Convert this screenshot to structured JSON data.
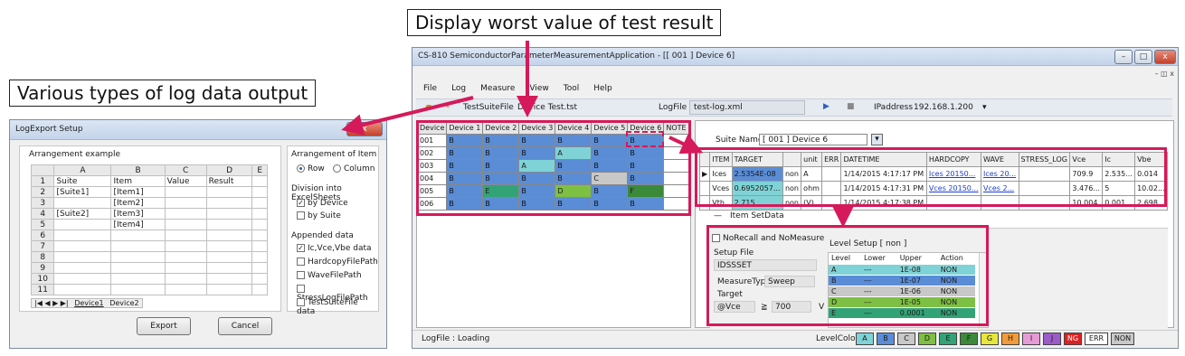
{
  "callouts": {
    "log": "Various types of log data output",
    "worst": "Display worst value of test result"
  },
  "export_dialog": {
    "title": "LogExport Setup",
    "close": "x",
    "arrangement_example": "Arrangement example",
    "columns": [
      "",
      "A",
      "B",
      "C",
      "D",
      "E"
    ],
    "rows": [
      [
        "1",
        "Suite",
        "Item",
        "Value",
        "Result",
        ""
      ],
      [
        "2",
        "[Suite1]",
        "[Item1]",
        "",
        "",
        ""
      ],
      [
        "3",
        "",
        "[Item2]",
        "",
        "",
        ""
      ],
      [
        "4",
        "[Suite2]",
        "[Item3]",
        "",
        "",
        ""
      ],
      [
        "5",
        "",
        "[Item4]",
        "",
        "",
        ""
      ],
      [
        "6",
        "",
        "",
        "",
        "",
        ""
      ],
      [
        "7",
        "",
        "",
        "",
        "",
        ""
      ],
      [
        "8",
        "",
        "",
        "",
        "",
        ""
      ],
      [
        "9",
        "",
        "",
        "",
        "",
        ""
      ],
      [
        "10",
        "",
        "",
        "",
        "",
        ""
      ],
      [
        "11",
        "",
        "",
        "",
        "",
        ""
      ]
    ],
    "sheet_nav": "|◀ ◀ ▶ ▶|",
    "sheet_tabs": [
      "Device1",
      "Device2"
    ],
    "arrangement_title": "Arrangement of Item",
    "row_label": "Row",
    "column_label": "Column",
    "division_title": "Division into ExcelSheets",
    "by_device": "by Device",
    "by_suite": "by Suite",
    "appended_title": "Appended data",
    "appended": [
      "Ic,Vce,Vbe data",
      "HardcopyFilePath",
      "WaveFilePath",
      "StressLogFilePath",
      "TestSuiteFile data"
    ],
    "appended_checked": [
      true,
      false,
      false,
      false,
      false
    ],
    "export": "Export",
    "cancel": "Cancel"
  },
  "app": {
    "title": "CS-810 SemiconductorParameterMeasurementApplication - [[ 001 ] Device 6]",
    "menu": [
      "File",
      "Log",
      "Measure",
      "View",
      "Tool",
      "Help"
    ],
    "suite_file": "TestSuiteFile",
    "suite_file_value": "Device Test.tst",
    "logfile_label": "LogFile",
    "logfile_value": "test-log.xml",
    "ip_label": "IPaddress",
    "ip_value": "192.168.1.200",
    "device_headers": [
      "Device",
      "Device 1",
      "Device 2",
      "Device 3",
      "Device 4",
      "Device 5",
      "Device 6",
      "NOTE"
    ],
    "device_rows": [
      {
        "id": "001",
        "cells": [
          "B",
          "B",
          "B",
          "B",
          "B",
          "B"
        ],
        "levels": [
          "B",
          "B",
          "B",
          "B",
          "B",
          "B"
        ]
      },
      {
        "id": "002",
        "cells": [
          "B",
          "B",
          "B",
          "A",
          "B",
          "B"
        ],
        "levels": [
          "B",
          "B",
          "B",
          "A",
          "B",
          "B"
        ]
      },
      {
        "id": "003",
        "cells": [
          "B",
          "B",
          "A",
          "B",
          "B",
          "B"
        ],
        "levels": [
          "B",
          "B",
          "A",
          "B",
          "B",
          "B"
        ]
      },
      {
        "id": "004",
        "cells": [
          "B",
          "B",
          "B",
          "B",
          "C",
          "B"
        ],
        "levels": [
          "B",
          "B",
          "B",
          "B",
          "C",
          "B"
        ]
      },
      {
        "id": "005",
        "cells": [
          "B",
          "E",
          "B",
          "D",
          "B",
          "F"
        ],
        "levels": [
          "B",
          "E",
          "B",
          "D",
          "B",
          "F"
        ]
      },
      {
        "id": "006",
        "cells": [
          "B",
          "B",
          "B",
          "B",
          "B",
          "B"
        ],
        "levels": [
          "B",
          "B",
          "B",
          "B",
          "B",
          "B"
        ]
      }
    ],
    "suite_name_label": "Suite Name",
    "suite_name_value": "[ 001 ] Device 6",
    "result_headers": [
      "",
      "ITEM",
      "TARGET",
      "",
      "unit",
      "ERR",
      "DATETIME",
      "HARDCOPY",
      "WAVE",
      "STRESS_LOG",
      "Vce",
      "Ic",
      "Vbe"
    ],
    "result_rows": [
      [
        "▶",
        "Ices",
        "2.5354E-08",
        "non",
        "A",
        "",
        "1/14/2015 4:17:17 PM",
        "Ices 20150...",
        "Ices 20...",
        "",
        "709.9",
        "2.535...",
        "0.014"
      ],
      [
        "",
        "Vces",
        "0.6952057...",
        "non",
        "ohm",
        "",
        "1/14/2015 4:17:31 PM",
        "Vces 20150...",
        "Vces 2...",
        "",
        "3.476...",
        "5",
        "10.02..."
      ],
      [
        "",
        "Vth",
        "2.715",
        "non",
        "(V)",
        "",
        "1/14/2015 4:17:38 PM",
        "",
        "",
        "",
        "10.004",
        "0.001...",
        "2.698"
      ]
    ],
    "item_setdata": "Item SetData",
    "no_recall": "NoRecall and NoMeasure",
    "setup_file_label": "Setup File",
    "setup_file_value": "IDSSSET",
    "measure_type_label": "MeasureType",
    "measure_type_value": "Sweep",
    "target_label": "Target",
    "target_param": "@Vce",
    "target_op": "≧",
    "target_value": "700",
    "target_unit": "V",
    "level_setup": "Level Setup [ non ]",
    "level_headers": [
      "Level",
      "Lower",
      "Upper",
      "Action"
    ],
    "level_rows": [
      {
        "level": "A",
        "lower": "---",
        "upper": "1E-08",
        "action": "NON",
        "color": "#7fd3d6"
      },
      {
        "level": "B",
        "lower": "---",
        "upper": "1E-07",
        "action": "NON",
        "color": "#5b8dd6"
      },
      {
        "level": "C",
        "lower": "---",
        "upper": "1E-06",
        "action": "NON",
        "color": "#c8c8c8"
      },
      {
        "level": "D",
        "lower": "---",
        "upper": "1E-05",
        "action": "NON",
        "color": "#7ec043"
      },
      {
        "level": "E",
        "lower": "---",
        "upper": "0.0001",
        "action": "NON",
        "color": "#32a377"
      }
    ],
    "status": "LogFile : Loading",
    "level_color_label": "LevelColor",
    "level_colors": [
      {
        "label": "A",
        "color": "#7fd3d6"
      },
      {
        "label": "B",
        "color": "#5b8dd6"
      },
      {
        "label": "C",
        "color": "#c8c8c8"
      },
      {
        "label": "D",
        "color": "#7ec043"
      },
      {
        "label": "E",
        "color": "#32a377"
      },
      {
        "label": "F",
        "color": "#3a8a3a"
      },
      {
        "label": "G",
        "color": "#e7e73a"
      },
      {
        "label": "H",
        "color": "#f29b3a"
      },
      {
        "label": "I",
        "color": "#e79bd6"
      },
      {
        "label": "J",
        "color": "#9b5bc8"
      },
      {
        "label": "NG",
        "color": "#e02020"
      },
      {
        "label": "ERR",
        "color": "#ffffff"
      },
      {
        "label": "NON",
        "color": "#c8c8c8"
      }
    ]
  }
}
